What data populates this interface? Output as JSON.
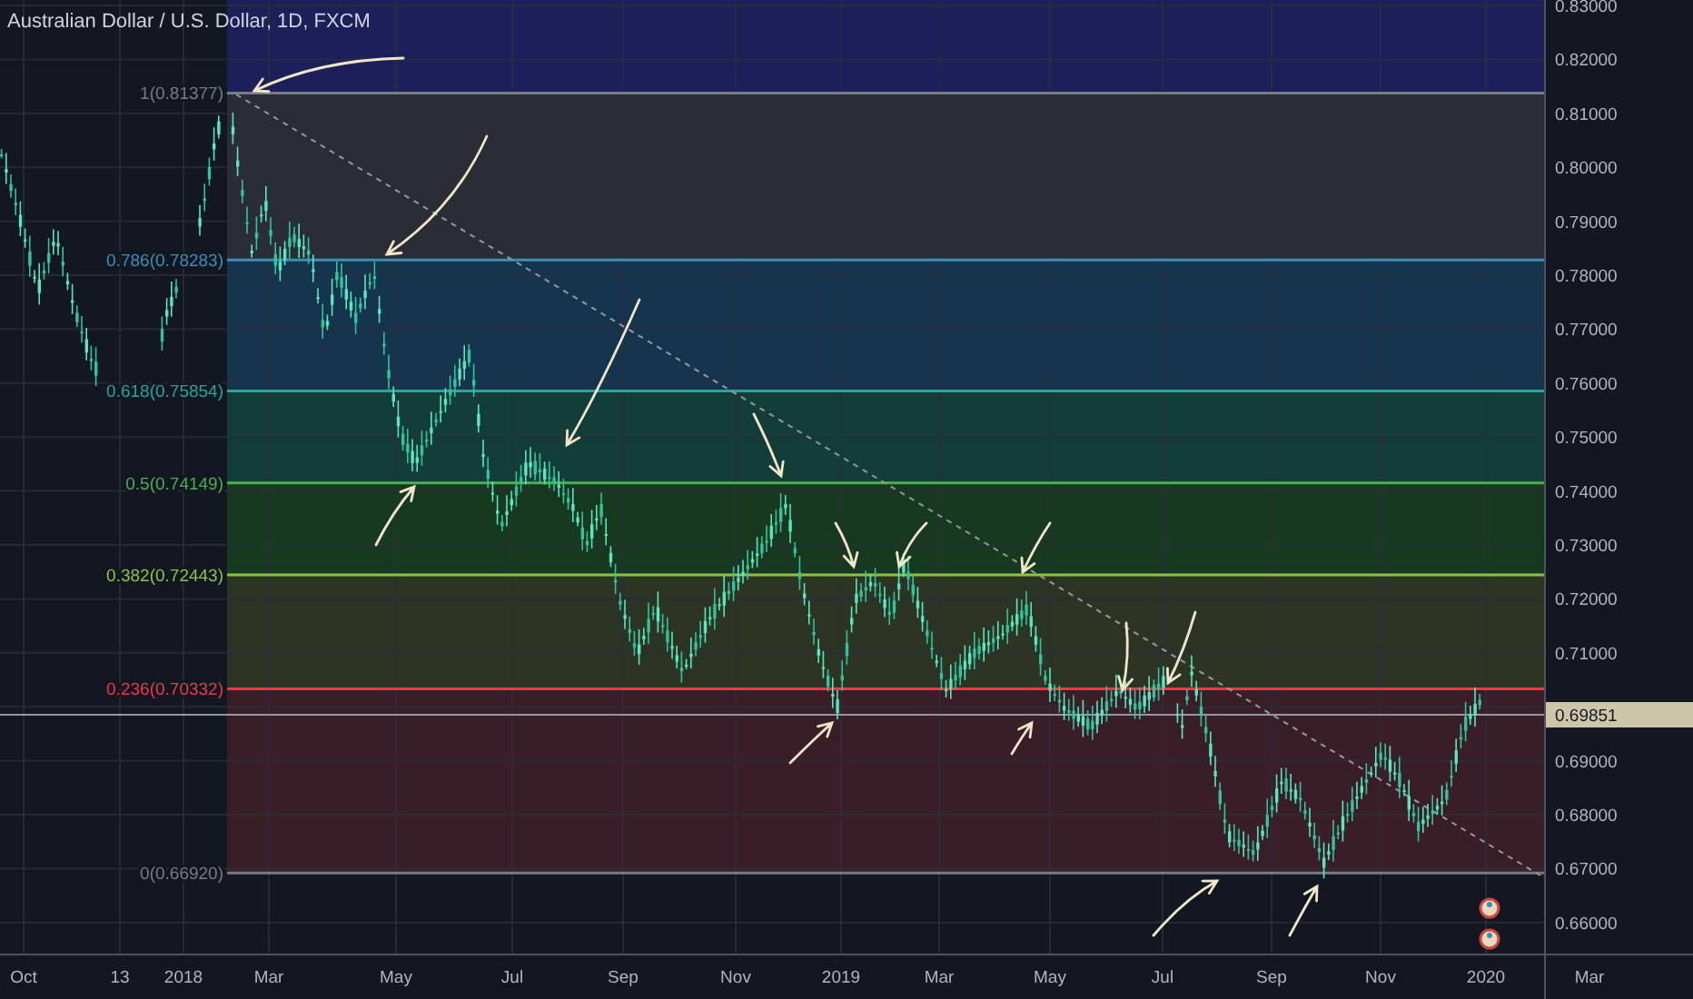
{
  "title": "Australian Dollar / U.S. Dollar, 1D, FXCM",
  "price_axis": {
    "labels": [
      "0.83000",
      "0.82000",
      "0.81000",
      "0.80000",
      "0.79000",
      "0.78000",
      "0.77000",
      "0.76000",
      "0.75000",
      "0.74000",
      "0.73000",
      "0.72000",
      "0.71000",
      "0.69000",
      "0.68000",
      "0.67000",
      "0.66000"
    ],
    "current_price": "0.69851"
  },
  "time_axis": {
    "labels": [
      "Oct",
      "13",
      "2018",
      "Mar",
      "May",
      "Jul",
      "Sep",
      "Nov",
      "2019",
      "Mar",
      "May",
      "Jul",
      "Sep",
      "Nov",
      "2020",
      "Mar"
    ]
  },
  "fib_levels": [
    {
      "label": "1(0.81377)",
      "color": "#787b86"
    },
    {
      "label": "0.786(0.78283)",
      "color": "#3c8fb5"
    },
    {
      "label": "0.618(0.75854)",
      "color": "#26a69a"
    },
    {
      "label": "0.5(0.74149)",
      "color": "#4caf50"
    },
    {
      "label": "0.382(0.72443)",
      "color": "#8bc34a"
    },
    {
      "label": "0.236(0.70332)",
      "color": "#f23645"
    },
    {
      "label": "0(0.66920)",
      "color": "#787b86"
    }
  ]
}
